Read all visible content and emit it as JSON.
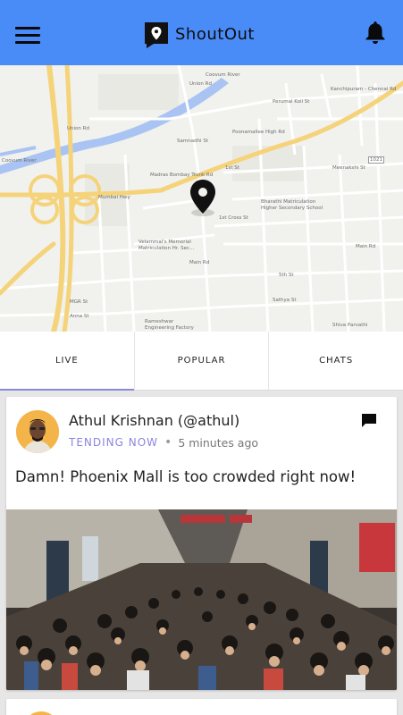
{
  "header": {
    "app_name": "ShoutOut",
    "menu_icon": "hamburger-menu-icon",
    "notification_icon": "bell-icon",
    "background_color": "#4a8cf7"
  },
  "map": {
    "labels": {
      "union_rd_top": "Union Rd",
      "union_rd_left": "Union Rd",
      "coovum_river_top": "Coovum River",
      "coovum_river_left": "Coovum River",
      "perumal_koil": "Perumal Koil St",
      "kanchipuram_chennai": "Kanchipuram - Chennai Rd",
      "samnadhi": "Samnadhi St",
      "poonamallee": "Poonamallee High Rd",
      "madras_bombay": "Madras Bombay Trunk Rd",
      "mumbai_hwy": "Mumbai Hwy",
      "meenakshi": "Meenakshi St",
      "first_st": "1st St",
      "first_cross": "1st Cross St",
      "main_rd": "Main Rd",
      "bharathi": "Bharathi Matriculation Higher Secondary School",
      "velammal": "Velammal's Memorial Matriculation Hr. Sec...",
      "mgr_st": "MGR St",
      "anna_st": "Anna St",
      "rameshwar": "Rameshwar Engineering Factory",
      "shiva_parvathi": "Shiva Parvathi",
      "sathya_st": "Sathya St",
      "fifth_st": "5th St",
      "main_rd_right": "Main Rd",
      "route_num": "1021"
    },
    "pin_icon": "location-pin-icon"
  },
  "tabs": [
    {
      "label": "LIVE",
      "active": true
    },
    {
      "label": "POPULAR",
      "active": false
    },
    {
      "label": "CHATS",
      "active": false
    }
  ],
  "post": {
    "author": "Athul Krishnan (@athul)",
    "status": "TENDING NOW",
    "separator": "•",
    "time": "5 minutes ago",
    "text": "Damn! Phoenix Mall is too crowded right now!",
    "action_icon": "chat-bubble-icon",
    "accent_color": "#8b84e0"
  }
}
